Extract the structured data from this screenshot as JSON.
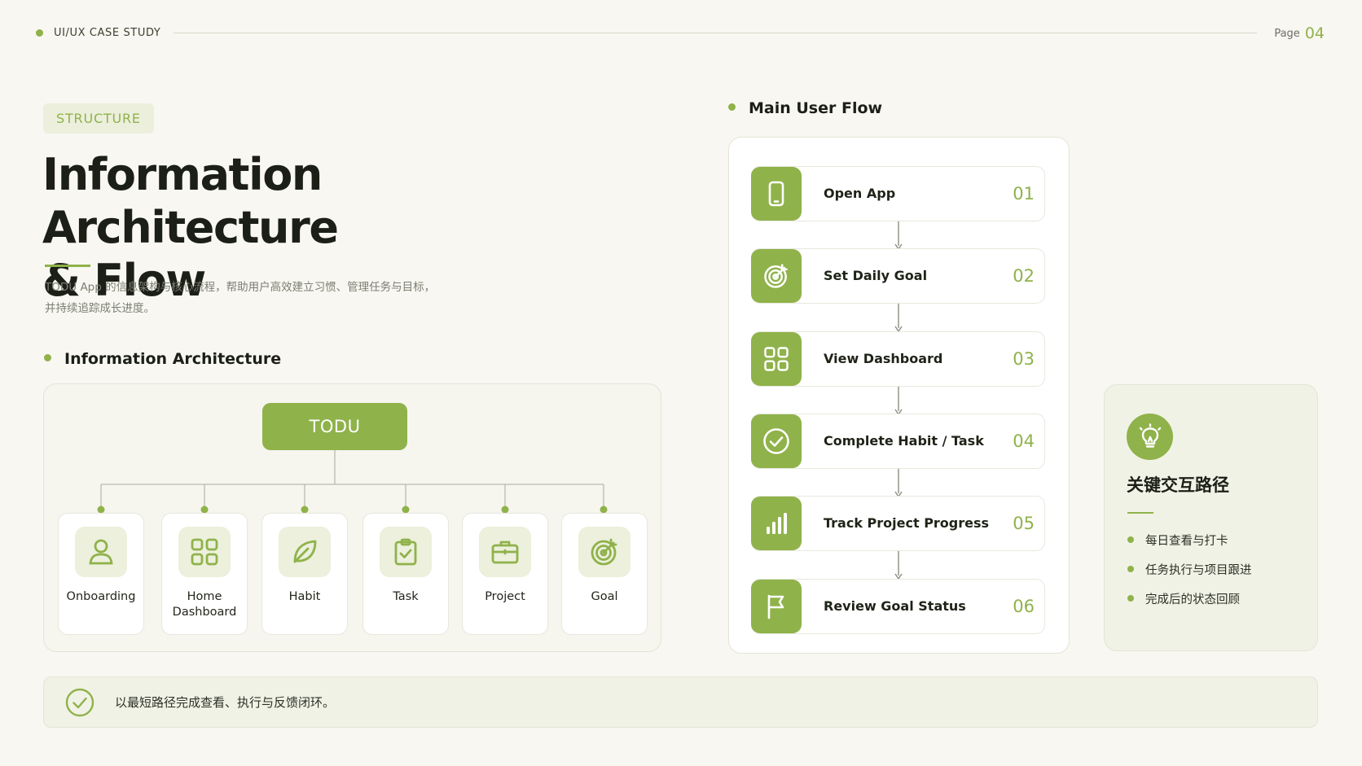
{
  "header": {
    "label": "UI/UX CASE STUDY",
    "page_label": "Page",
    "page_number": "04"
  },
  "section_tag": "STRUCTURE",
  "title": {
    "line1": "Information Architecture",
    "line2": "& Flow"
  },
  "intro": {
    "line1": "TODU App 的信息架构与核心流程，帮助用户高效建立习惯、管理任务与目标，",
    "line2": "并持续追踪成长进度。"
  },
  "ia": {
    "heading": "Information Architecture",
    "root": "TODU",
    "nodes": [
      {
        "line1": "Onboarding",
        "line2": "",
        "icon": "user-icon"
      },
      {
        "line1": "Home",
        "line2": "Dashboard",
        "icon": "dashboard-grid-icon"
      },
      {
        "line1": "Habit",
        "line2": "",
        "icon": "leaf-icon"
      },
      {
        "line1": "Task",
        "line2": "",
        "icon": "clipboard-check-icon"
      },
      {
        "line1": "Project",
        "line2": "",
        "icon": "briefcase-icon"
      },
      {
        "line1": "Goal",
        "line2": "",
        "icon": "target-icon"
      }
    ]
  },
  "flow": {
    "heading": "Main User Flow",
    "steps": [
      {
        "label": "Open App",
        "num": "01",
        "icon": "phone-icon"
      },
      {
        "label": "Set Daily Goal",
        "num": "02",
        "icon": "target-icon"
      },
      {
        "label": "View Dashboard",
        "num": "03",
        "icon": "dashboard-grid-icon"
      },
      {
        "label": "Complete Habit / Task",
        "num": "04",
        "icon": "check-circle-icon"
      },
      {
        "label": "Track Project Progress",
        "num": "05",
        "icon": "bar-chart-icon"
      },
      {
        "label": "Review Goal Status",
        "num": "06",
        "icon": "flag-icon"
      }
    ]
  },
  "insight": {
    "icon": "lightbulb-icon",
    "title": "关键交互路径",
    "items": [
      "每日查看与打卡",
      "任务执行与项目跟进",
      "完成后的状态回顾"
    ]
  },
  "footer": {
    "icon": "check-circle-icon",
    "text": "以最短路径完成查看、执行与反馈闭环。"
  },
  "colors": {
    "accent": "#8fb24a",
    "background": "#f8f7f1",
    "tint": "#ecf0dc",
    "text": "#1e2317"
  }
}
